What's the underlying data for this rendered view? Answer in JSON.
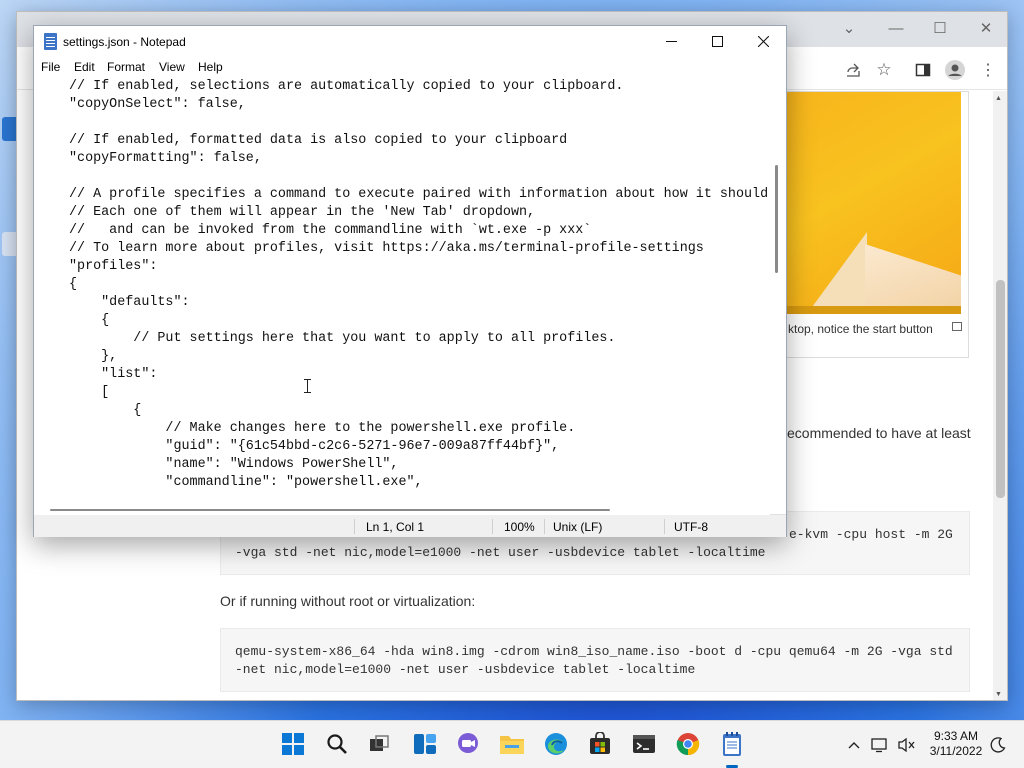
{
  "notepad": {
    "title": "settings.json - Notepad",
    "menu": [
      "File",
      "Edit",
      "Format",
      "View",
      "Help"
    ],
    "content_lines": [
      "// If enabled, selections are automatically copied to your clipboard.",
      "\"copyOnSelect\": false,",
      "",
      "// If enabled, formatted data is also copied to your clipboard",
      "\"copyFormatting\": false,",
      "",
      "// A profile specifies a command to execute paired with information about how it should",
      "// Each one of them will appear in the 'New Tab' dropdown,",
      "//   and can be invoked from the commandline with `wt.exe -p xxx`",
      "// To learn more about profiles, visit https://aka.ms/terminal-profile-settings",
      "\"profiles\":",
      "{",
      "    \"defaults\":",
      "    {",
      "        // Put settings here that you want to apply to all profiles.",
      "    },",
      "    \"list\":",
      "    [",
      "        {",
      "            // Make changes here to the powershell.exe profile.",
      "            \"guid\": \"{61c54bbd-c2c6-5271-96e7-009a87ff44bf}\",",
      "            \"name\": \"Windows PowerShell\",",
      "            \"commandline\": \"powershell.exe\","
    ],
    "status": {
      "position": "Ln 1, Col 1",
      "zoom": "100%",
      "line_endings": "Unix (LF)",
      "encoding": "UTF-8"
    }
  },
  "browser": {
    "figure_caption": "ktop, notice the start button",
    "text_recommended": "ecommended to have at least",
    "code1_line1": "e-kvm -cpu host -m 2G",
    "code1_line2": "-vga std -net nic,model=e1000 -net user -usbdevice tablet -localtime",
    "text_or": "Or if running without root or virtualization:",
    "code2_line1": "qemu-system-x86_64 -hda win8.img -cdrom win8_iso_name.iso -boot d -cpu qemu64 -m 2G -vga std",
    "code2_line2": "-net nic,model=e1000 -net user -usbdevice tablet -localtime"
  },
  "taskbar": {
    "time": "9:33 AM",
    "date": "3/11/2022",
    "apps": [
      "windows-start",
      "search",
      "task-view",
      "widgets",
      "chat",
      "file-explorer",
      "edge",
      "store",
      "terminal",
      "chrome",
      "notepad"
    ]
  },
  "colors": {
    "accent": "#0067c0",
    "taskbar_bg": "#f3f3f3",
    "status_bg": "#f0f0f0"
  }
}
